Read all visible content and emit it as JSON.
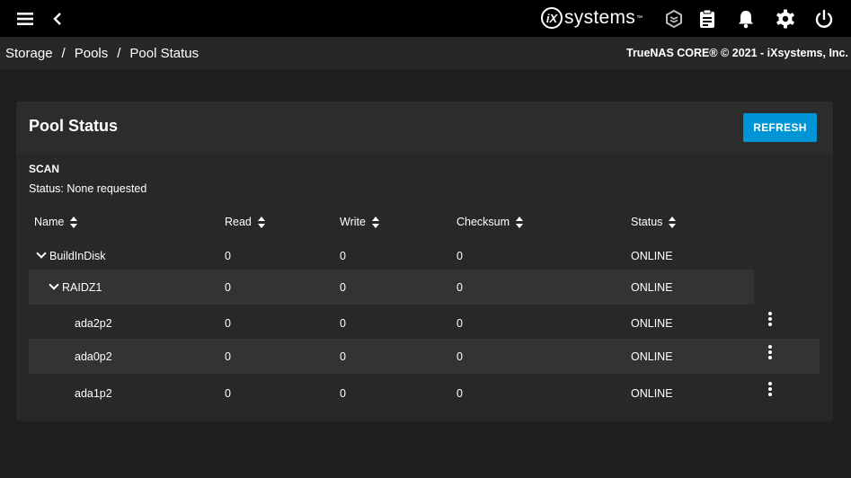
{
  "topbar": {
    "menu_icon": "hamburger-menu-icon",
    "back_icon": "chevron-left-icon",
    "logo_ix": "iX",
    "logo_text": "systems",
    "logo_tm": "™",
    "icons": [
      "truecommand-icon",
      "task-manager-icon",
      "notifications-icon",
      "settings-icon",
      "power-icon"
    ]
  },
  "breadcrumb": {
    "items": [
      "Storage",
      "Pools",
      "Pool Status"
    ],
    "separator": "/"
  },
  "copyright": "TrueNAS CORE® © 2021 - iXsystems, Inc.",
  "card": {
    "title": "Pool Status",
    "refresh_label": "REFRESH"
  },
  "scan": {
    "title": "SCAN",
    "status": "Status: None requested"
  },
  "table": {
    "columns": [
      "Name",
      "Read",
      "Write",
      "Checksum",
      "Status"
    ],
    "rows": [
      {
        "name": "BuildInDisk",
        "read": "0",
        "write": "0",
        "checksum": "0",
        "status": "ONLINE"
      },
      {
        "name": "RAIDZ1",
        "read": "0",
        "write": "0",
        "checksum": "0",
        "status": "ONLINE"
      },
      {
        "name": "ada2p2",
        "read": "0",
        "write": "0",
        "checksum": "0",
        "status": "ONLINE"
      },
      {
        "name": "ada0p2",
        "read": "0",
        "write": "0",
        "checksum": "0",
        "status": "ONLINE"
      },
      {
        "name": "ada1p2",
        "read": "0",
        "write": "0",
        "checksum": "0",
        "status": "ONLINE"
      }
    ]
  },
  "colors": {
    "accent": "#0095d5",
    "topbar_bg": "#000000",
    "page_bg": "#1e1e1e",
    "card_bg": "#282828"
  }
}
